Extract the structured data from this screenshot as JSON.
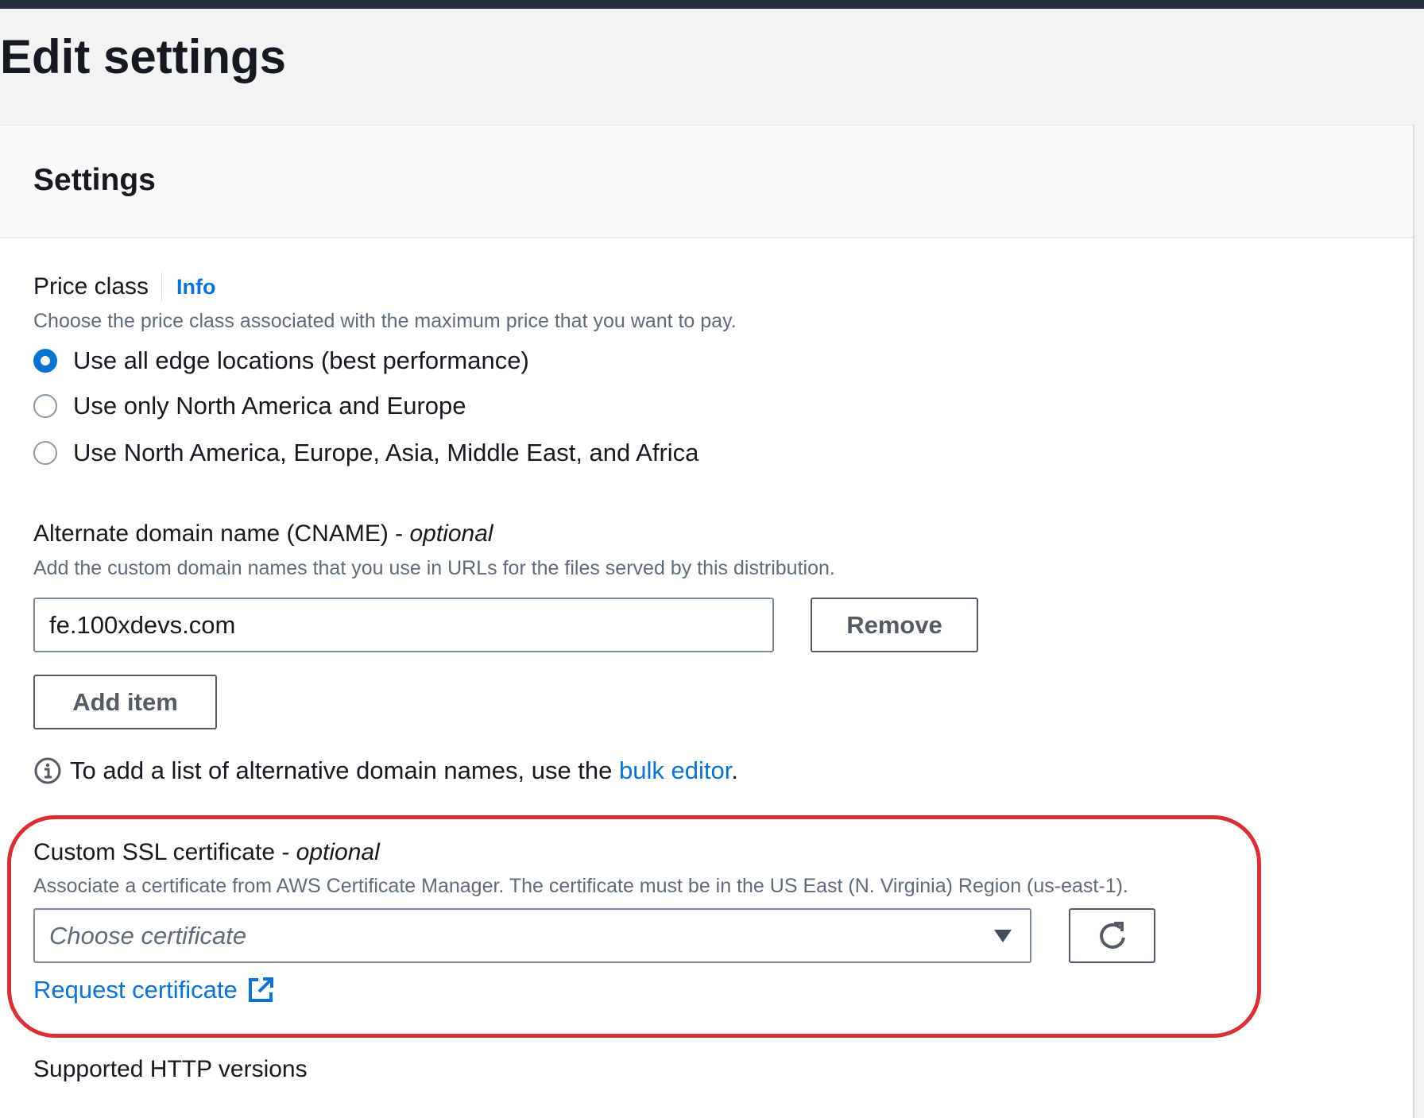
{
  "page": {
    "title": "Edit settings"
  },
  "panel": {
    "heading": "Settings"
  },
  "price_class": {
    "label": "Price class",
    "info": "Info",
    "description": "Choose the price class associated with the maximum price that you want to pay.",
    "options": [
      {
        "label": "Use all edge locations (best performance)",
        "selected": true
      },
      {
        "label": "Use only North America and Europe",
        "selected": false
      },
      {
        "label": "Use North America, Europe, Asia, Middle East, and Africa",
        "selected": false
      }
    ]
  },
  "cname": {
    "label": "Alternate domain name (CNAME) - ",
    "optional": "optional",
    "description": "Add the custom domain names that you use in URLs for the files served by this distribution.",
    "value": "fe.100xdevs.com",
    "remove_label": "Remove",
    "add_label": "Add item",
    "bulk_prefix": "To add a list of alternative domain names, use the ",
    "bulk_link": "bulk editor",
    "bulk_suffix": "."
  },
  "ssl": {
    "label": "Custom SSL certificate - ",
    "optional": "optional",
    "description": "Associate a certificate from AWS Certificate Manager. The certificate must be in the US East (N. Virginia) Region (us-east-1).",
    "placeholder": "Choose certificate",
    "request_link": "Request certificate"
  },
  "http": {
    "label": "Supported HTTP versions"
  },
  "colors": {
    "accent": "#0972d3",
    "annotation": "#d93036",
    "topbar": "#232f3e"
  }
}
